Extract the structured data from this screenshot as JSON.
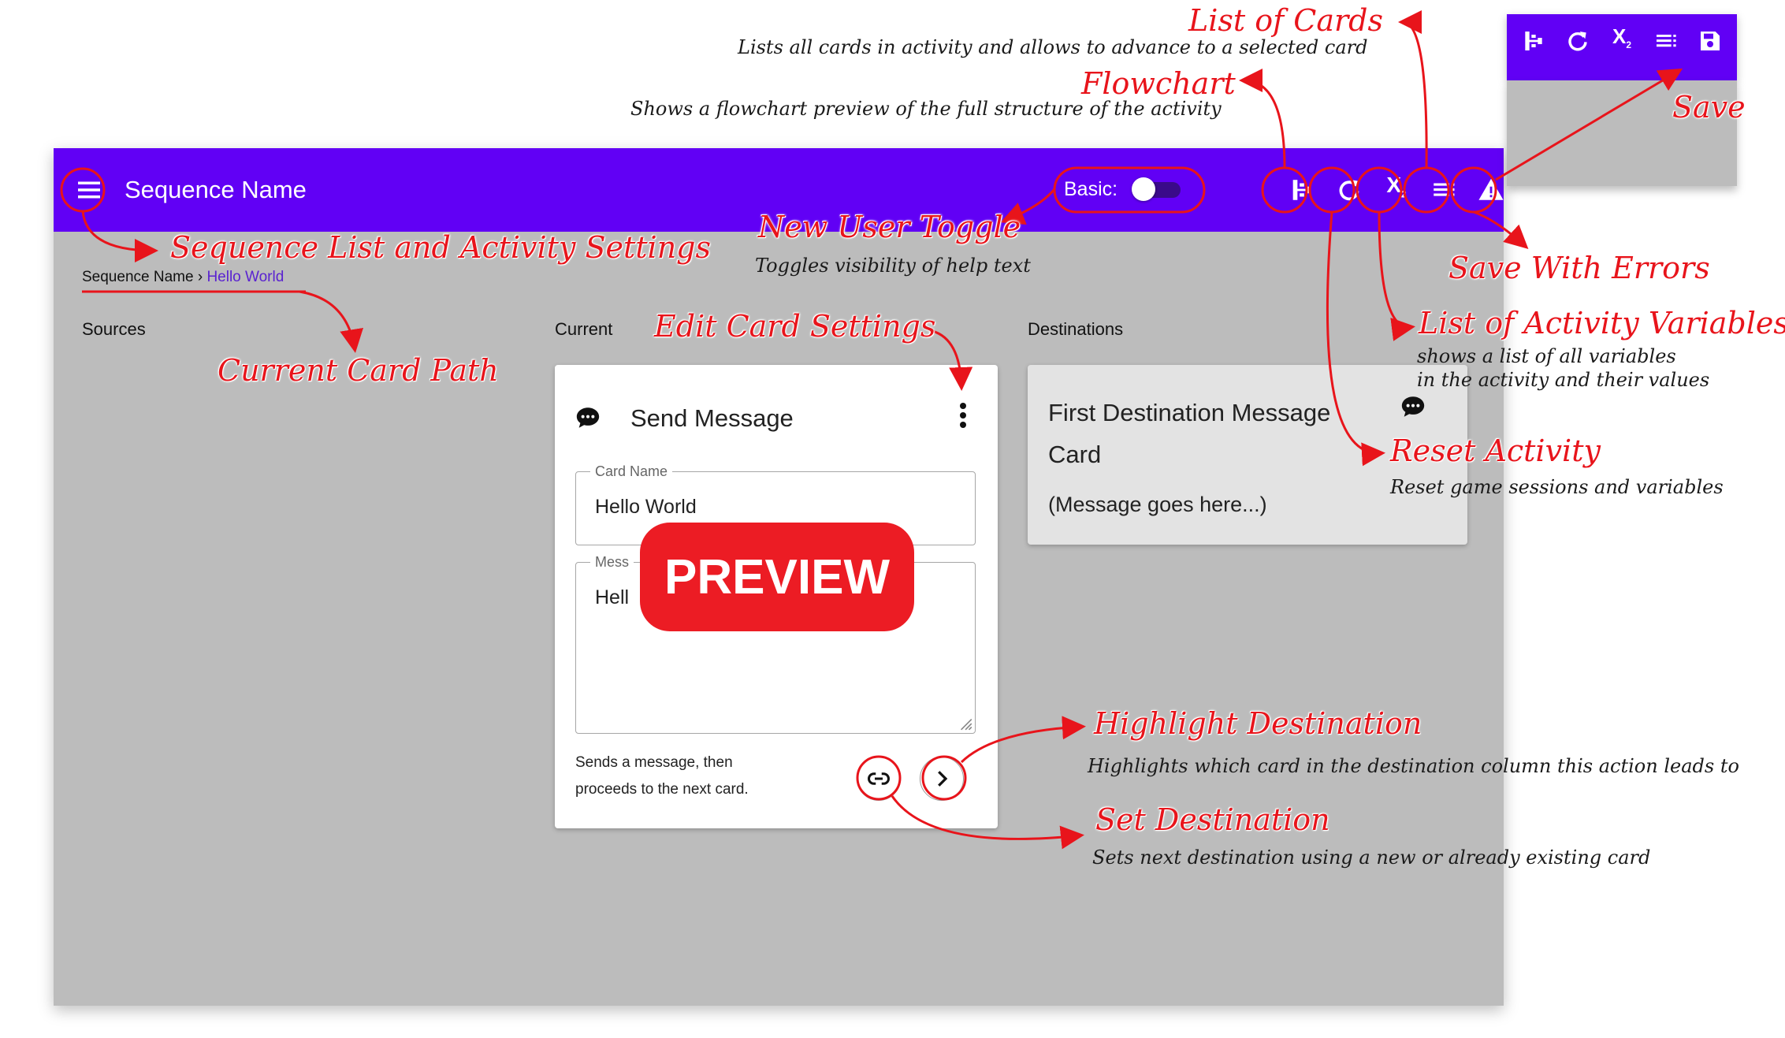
{
  "appbar": {
    "title": "Sequence Name",
    "basic_label": "Basic:",
    "icons": [
      "flowchart-icon",
      "reset-icon",
      "variables-icon",
      "list-icon",
      "warning-icon"
    ]
  },
  "breadcrumb": {
    "root": "Sequence Name",
    "separator": "›",
    "current": "Hello World"
  },
  "columns": {
    "sources": "Sources",
    "current": "Current",
    "destinations": "Destinations"
  },
  "current_card": {
    "title": "Send Message",
    "name_label": "Card Name",
    "name_value": "Hello World",
    "message_label": "Mess",
    "message_value": "Hell",
    "description_line1": "Sends a message, then",
    "description_line2": "proceeds to the next card."
  },
  "preview_badge": "PREVIEW",
  "destination_card": {
    "title_line1": "First Destination Message",
    "title_line2": "Card",
    "subtitle": "(Message goes here...)"
  },
  "annotations": {
    "list_of_cards": {
      "title": "List of Cards",
      "sub": "Lists all cards in activity and allows to advance to a selected card"
    },
    "flowchart": {
      "title": "Flowchart",
      "sub": "Shows a flowchart preview of the full structure of the activity"
    },
    "save": {
      "title": "Save"
    },
    "sequence_list": {
      "title": "Sequence List and Activity Settings"
    },
    "new_user_toggle": {
      "title": "New User Toggle",
      "sub": "Toggles visibility of help text"
    },
    "save_with_errors": {
      "title": "Save With Errors"
    },
    "current_card_path": {
      "title": "Current Card Path"
    },
    "edit_card_settings": {
      "title": "Edit Card Settings"
    },
    "list_of_variables": {
      "title": "List of Activity Variables",
      "sub1": "shows a list of all variables",
      "sub2": "in the activity and their values"
    },
    "reset_activity": {
      "title": "Reset Activity",
      "sub": "Reset game sessions and variables"
    },
    "highlight_destination": {
      "title": "Highlight Destination",
      "sub": "Highlights which card in the destination column this action leads to"
    },
    "set_destination": {
      "title": "Set Destination",
      "sub": "Sets next destination using a new or already existing card"
    }
  },
  "colors": {
    "appbar": "#6100f5",
    "canvas": "#bcbcbc",
    "annotation": "#e8141b",
    "preview": "#ec1c24"
  }
}
